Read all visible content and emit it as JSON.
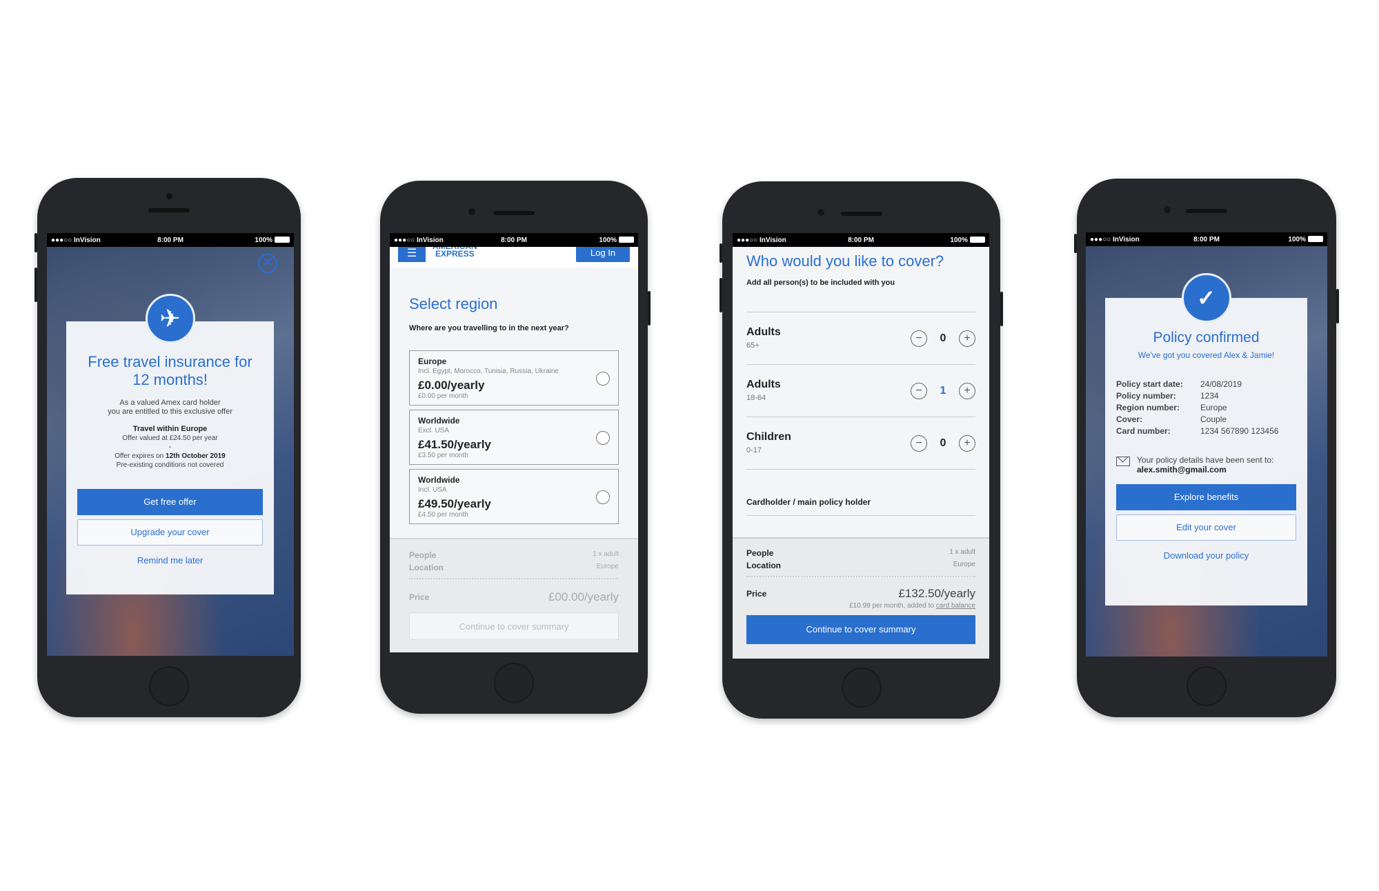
{
  "status_bar": {
    "carrier": "●●●○○ InVision",
    "time": "8:00 PM",
    "battery": "100%"
  },
  "colors": {
    "accent": "#2a6fcd",
    "phone_frame": "#26272b"
  },
  "screen1": {
    "close_icon": "close-circle-icon",
    "hero_icon": "airplane-icon",
    "title": "Free travel insurance for 12 months!",
    "intro_line1": "As a valued Amex card holder",
    "intro_line2": "you are entitled to this exclusive offer",
    "offer_title": "Travel within Europe",
    "offer_value": "Offer valued at £24.50 per year",
    "separator": "-",
    "expires_prefix": "Offer expires on ",
    "expires_date": "12th October 2019",
    "conditions": "Pre-existing conditions not covered",
    "primary_button": "Get free offer",
    "secondary_button": "Upgrade your cover",
    "link": "Remind me later"
  },
  "screen2": {
    "menu_icon": "hamburger-menu-icon",
    "logo_line1": "AMERICAN",
    "logo_line2": "EXPRESS",
    "login_button": "Log In",
    "title": "Select region",
    "question": "Where are you travelling to in the next year?",
    "regions": [
      {
        "name": "Europe",
        "detail": "Incl. Egypt, Morocco, Tunisia, Russia, Ukraine",
        "price": "£0.00/yearly",
        "monthly": "£0.00 per month",
        "selected": false
      },
      {
        "name": "Worldwide",
        "detail": "Excl. USA",
        "price": "£41.50/yearly",
        "monthly": "£3.50 per month",
        "selected": false
      },
      {
        "name": "Worldwide",
        "detail": "Incl. USA",
        "price": "£49.50/yearly",
        "monthly": "£4.50 per month",
        "selected": false
      }
    ],
    "summary": {
      "people_label": "People",
      "people_value": "1 x adult",
      "location_label": "Location",
      "location_value": "Europe",
      "price_label": "Price",
      "price_value": "£00.00/yearly"
    },
    "continue_button": "Continue to cover summary"
  },
  "screen3": {
    "title": "Who would you like to cover?",
    "subtitle": "Add all person(s) to be included with you",
    "persons": [
      {
        "label": "Adults",
        "range": "65+",
        "count": "0"
      },
      {
        "label": "Adults",
        "range": "18-64",
        "count": "1"
      },
      {
        "label": "Children",
        "range": "0-17",
        "count": "0"
      }
    ],
    "minus": "−",
    "plus": "+",
    "cardholder_label": "Cardholder / main policy holder",
    "summary": {
      "people_label": "People",
      "people_value": "1 x adult",
      "location_label": "Location",
      "location_value": "Europe",
      "price_label": "Price",
      "price_value": "£132.50/yearly",
      "monthly_prefix": "£10.99 per month, added to ",
      "monthly_link": "card balance"
    },
    "continue_button": "Continue to cover summary"
  },
  "screen4": {
    "hero_icon": "checkmark-icon",
    "title": "Policy confirmed",
    "subtitle": "We've got you covered Alex & Jamie!",
    "details": [
      {
        "label": "Policy start date:",
        "value": "24/08/2019"
      },
      {
        "label": "Policy number:",
        "value": "1234"
      },
      {
        "label": "Region number:",
        "value": "Europe"
      },
      {
        "label": "Cover:",
        "value": "Couple"
      },
      {
        "label": "Card number:",
        "value": "1234 567890 123456"
      }
    ],
    "email_icon": "envelope-icon",
    "sent_text": "Your policy details have been sent to:",
    "email": "alex.smith@gmail.com",
    "primary_button": "Explore benefits",
    "secondary_button": "Edit your cover",
    "link": "Download your policy"
  }
}
